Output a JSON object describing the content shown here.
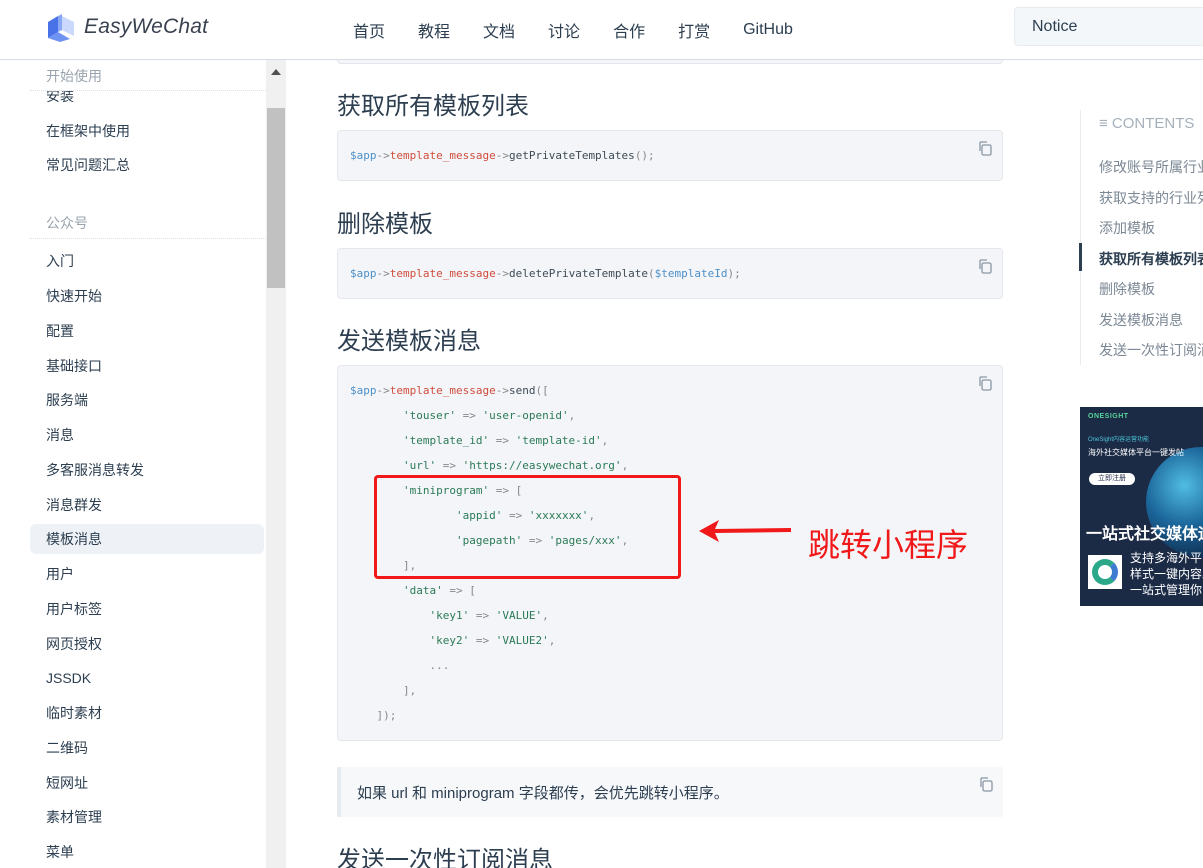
{
  "header": {
    "brand": "EasyWeChat",
    "nav": [
      "首页",
      "教程",
      "文档",
      "讨论",
      "合作",
      "打赏",
      "GitHub"
    ],
    "search_value": "Notice"
  },
  "sidebar": {
    "groups": [
      {
        "title": "开始使用",
        "items": [
          "安装",
          "在框架中使用",
          "常见问题汇总"
        ]
      },
      {
        "title": "公众号",
        "items": [
          "入门",
          "快速开始",
          "配置",
          "基础接口",
          "服务端",
          "消息",
          "多客服消息转发",
          "消息群发",
          "模板消息",
          "用户",
          "用户标签",
          "网页授权",
          "JSSDK",
          "临时素材",
          "二维码",
          "短网址",
          "素材管理",
          "菜单"
        ]
      }
    ],
    "active_item": "模板消息"
  },
  "main": {
    "sections": [
      {
        "heading": "获取所有模板列表",
        "code": [
          [
            {
              "t": "var",
              "v": "$app"
            },
            {
              "t": "p",
              "v": "->"
            },
            {
              "t": "prop",
              "v": "template_message"
            },
            {
              "t": "p",
              "v": "->"
            },
            {
              "t": "fn",
              "v": "getPrivateTemplates"
            },
            {
              "t": "p",
              "v": "();"
            }
          ]
        ]
      },
      {
        "heading": "删除模板",
        "code": [
          [
            {
              "t": "var",
              "v": "$app"
            },
            {
              "t": "p",
              "v": "->"
            },
            {
              "t": "prop",
              "v": "template_message"
            },
            {
              "t": "p",
              "v": "->"
            },
            {
              "t": "fn",
              "v": "deletePrivateTemplate"
            },
            {
              "t": "p",
              "v": "("
            },
            {
              "t": "var",
              "v": "$templateId"
            },
            {
              "t": "p",
              "v": ");"
            }
          ]
        ]
      },
      {
        "heading": "发送模板消息",
        "code": [
          [
            {
              "t": "var",
              "v": "$app"
            },
            {
              "t": "p",
              "v": "->"
            },
            {
              "t": "prop",
              "v": "template_message"
            },
            {
              "t": "p",
              "v": "->"
            },
            {
              "t": "fn",
              "v": "send"
            },
            {
              "t": "p",
              "v": "(["
            }
          ],
          [
            {
              "t": "p",
              "v": "        "
            },
            {
              "t": "str",
              "v": "'touser'"
            },
            {
              "t": "p",
              "v": " => "
            },
            {
              "t": "str",
              "v": "'user-openid'"
            },
            {
              "t": "p",
              "v": ","
            }
          ],
          [
            {
              "t": "p",
              "v": "        "
            },
            {
              "t": "str",
              "v": "'template_id'"
            },
            {
              "t": "p",
              "v": " => "
            },
            {
              "t": "str",
              "v": "'template-id'"
            },
            {
              "t": "p",
              "v": ","
            }
          ],
          [
            {
              "t": "p",
              "v": "        "
            },
            {
              "t": "str",
              "v": "'url'"
            },
            {
              "t": "p",
              "v": " => "
            },
            {
              "t": "str",
              "v": "'https://easywechat.org'"
            },
            {
              "t": "p",
              "v": ","
            }
          ],
          [
            {
              "t": "p",
              "v": "        "
            },
            {
              "t": "str",
              "v": "'miniprogram'"
            },
            {
              "t": "p",
              "v": " => ["
            }
          ],
          [
            {
              "t": "p",
              "v": "                "
            },
            {
              "t": "str",
              "v": "'appid'"
            },
            {
              "t": "p",
              "v": " => "
            },
            {
              "t": "str",
              "v": "'xxxxxxx'"
            },
            {
              "t": "p",
              "v": ","
            }
          ],
          [
            {
              "t": "p",
              "v": "                "
            },
            {
              "t": "str",
              "v": "'pagepath'"
            },
            {
              "t": "p",
              "v": " => "
            },
            {
              "t": "str",
              "v": "'pages/xxx'"
            },
            {
              "t": "p",
              "v": ","
            }
          ],
          [
            {
              "t": "p",
              "v": "        ],"
            }
          ],
          [
            {
              "t": "p",
              "v": "        "
            },
            {
              "t": "str",
              "v": "'data'"
            },
            {
              "t": "p",
              "v": " => ["
            }
          ],
          [
            {
              "t": "p",
              "v": "            "
            },
            {
              "t": "str",
              "v": "'key1'"
            },
            {
              "t": "p",
              "v": " => "
            },
            {
              "t": "str",
              "v": "'VALUE'"
            },
            {
              "t": "p",
              "v": ","
            }
          ],
          [
            {
              "t": "p",
              "v": "            "
            },
            {
              "t": "str",
              "v": "'key2'"
            },
            {
              "t": "p",
              "v": " => "
            },
            {
              "t": "str",
              "v": "'VALUE2'"
            },
            {
              "t": "p",
              "v": ","
            }
          ],
          [
            {
              "t": "p",
              "v": "            ..."
            }
          ],
          [
            {
              "t": "p",
              "v": "        ],"
            }
          ],
          [
            {
              "t": "p",
              "v": "    ]);"
            }
          ]
        ]
      }
    ],
    "tip": "如果 url 和 miniprogram 字段都传，会优先跳转小程序。",
    "next_heading": "发送一次性订阅消息",
    "annotation": "跳转小程序"
  },
  "toc": {
    "title": "≡ CONTENTS",
    "items": [
      "修改账号所属行业",
      "获取支持的行业列表",
      "添加模板",
      "获取所有模板列表",
      "删除模板",
      "发送模板消息",
      "发送一次性订阅消息"
    ],
    "active_index": 3
  },
  "ad": {
    "brand": "ONESIGHT",
    "sub1": "OneSight内容运营功能",
    "sub2": "海外社交媒体平台一键发帖",
    "cta": "立即注册",
    "headline": "一站式社交媒体运营",
    "desc": [
      "支持多海外平台",
      "样式一键内容发布",
      "一站式管理你的"
    ]
  }
}
